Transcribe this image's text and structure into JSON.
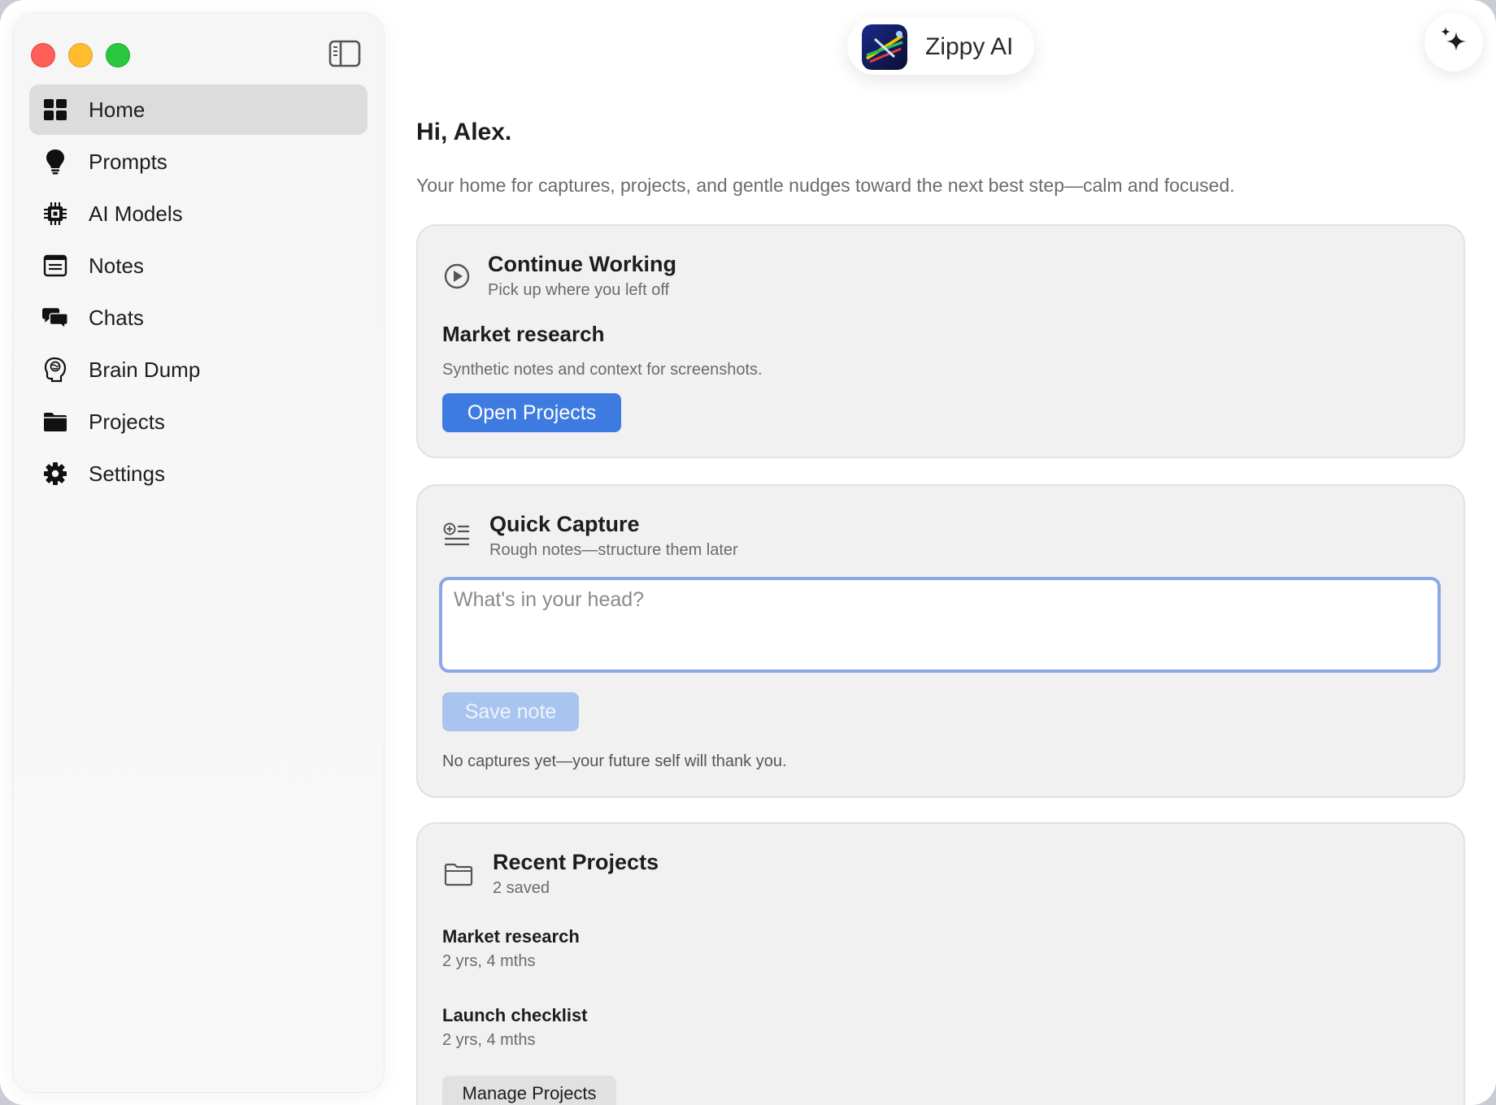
{
  "header": {
    "app_name": "Zippy AI",
    "logo_icon": "app-logo-icon",
    "assistant_icon": "sparkles-icon"
  },
  "sidebar": {
    "toggle_icon": "sidebar-toggle-icon",
    "items": [
      {
        "label": "Home",
        "icon": "grid-icon",
        "active": true
      },
      {
        "label": "Prompts",
        "icon": "lightbulb-icon"
      },
      {
        "label": "AI Models",
        "icon": "chip-icon"
      },
      {
        "label": "Notes",
        "icon": "notes-icon"
      },
      {
        "label": "Chats",
        "icon": "chat-bubbles-icon"
      },
      {
        "label": "Brain Dump",
        "icon": "brain-icon"
      },
      {
        "label": "Projects",
        "icon": "folder-icon"
      },
      {
        "label": "Settings",
        "icon": "gear-icon"
      }
    ]
  },
  "main": {
    "greeting": "Hi, Alex.",
    "intro": "Your home for captures, projects, and gentle nudges toward the next best step—calm and focused.",
    "continue_working": {
      "title": "Continue Working",
      "subtitle": "Pick up where you left off",
      "project_name": "Market research",
      "project_desc": "Synthetic notes and context for screenshots.",
      "button": "Open Projects"
    },
    "quick_capture": {
      "title": "Quick Capture",
      "subtitle": "Rough notes—structure them later",
      "placeholder": "What's in your head?",
      "value": "",
      "save_button": "Save note",
      "empty_text": "No captures yet—your future self will thank you."
    },
    "recent_projects": {
      "title": "Recent Projects",
      "subtitle": "2 saved",
      "items": [
        {
          "name": "Market research",
          "age": "2 yrs, 4 mths"
        },
        {
          "name": "Launch checklist",
          "age": "2 yrs, 4 mths"
        }
      ],
      "button": "Manage Projects"
    }
  },
  "colors": {
    "accent": "#3e7be0",
    "accent_disabled": "#a9c4ee",
    "card_bg": "#f1f1f1",
    "sidebar_active": "#dcdcdc"
  }
}
